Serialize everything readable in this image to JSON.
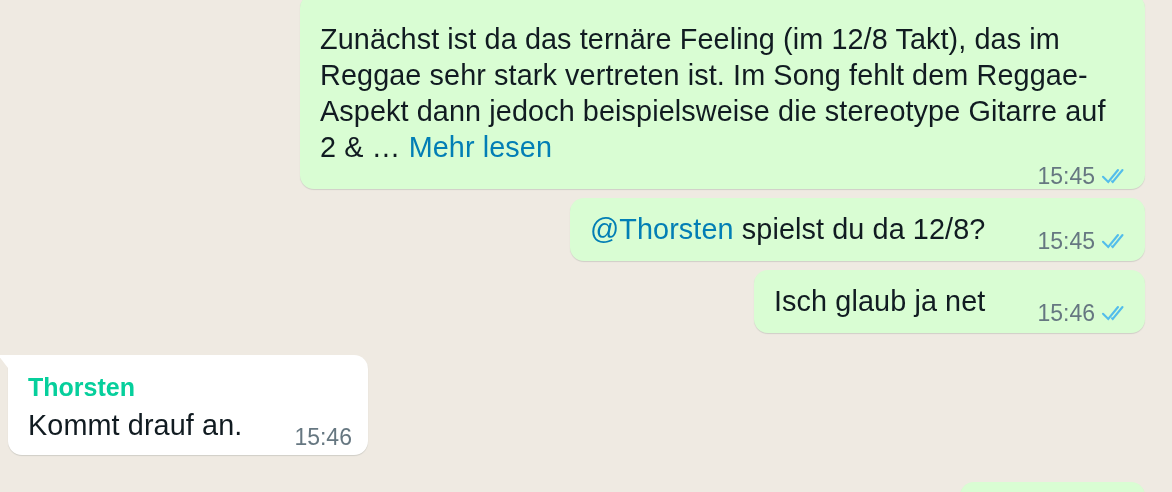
{
  "messages": [
    {
      "outgoing": true,
      "parts": [
        {
          "kind": "text",
          "text": "Zunächst ist da das ternäre Feeling (im 12/8 Takt), das im Reggae sehr stark vertreten ist. Im Song fehlt dem Reggae-Aspekt dann jedoch beispielsweise die stereotype Gitarre auf 2 & …"
        },
        {
          "kind": "link",
          "text": "Mehr lesen"
        }
      ],
      "time": "15:45",
      "read": true
    },
    {
      "outgoing": true,
      "parts": [
        {
          "kind": "mention",
          "text": "@Thorsten"
        },
        {
          "kind": "text",
          "text": "spielst du da 12/8?"
        }
      ],
      "time": "15:45",
      "read": true
    },
    {
      "outgoing": true,
      "parts": [
        {
          "kind": "text",
          "text": "Isch glaub ja net"
        }
      ],
      "time": "15:46",
      "read": true
    },
    {
      "outgoing": false,
      "sender": "Thorsten",
      "color": "#06cf9c",
      "parts": [
        {
          "kind": "text",
          "text": "Kommt drauf an."
        }
      ],
      "time": "15:46"
    }
  ]
}
